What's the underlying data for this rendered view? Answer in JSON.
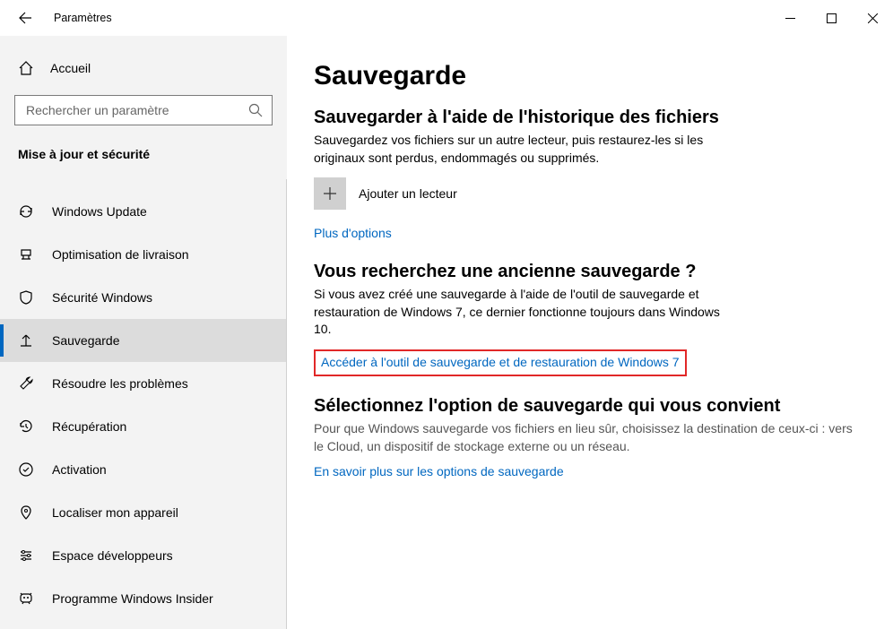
{
  "window": {
    "title": "Paramètres"
  },
  "sidebar": {
    "home": "Accueil",
    "search_placeholder": "Rechercher un paramètre",
    "section_label": "Mise à jour et sécurité",
    "items": [
      {
        "label": "Windows Update",
        "selected": false
      },
      {
        "label": "Optimisation de livraison",
        "selected": false
      },
      {
        "label": "Sécurité Windows",
        "selected": false
      },
      {
        "label": "Sauvegarde",
        "selected": true
      },
      {
        "label": "Résoudre les problèmes",
        "selected": false
      },
      {
        "label": "Récupération",
        "selected": false
      },
      {
        "label": "Activation",
        "selected": false
      },
      {
        "label": "Localiser mon appareil",
        "selected": false
      },
      {
        "label": "Espace développeurs",
        "selected": false
      },
      {
        "label": "Programme Windows Insider",
        "selected": false
      }
    ]
  },
  "main": {
    "page_title": "Sauvegarde",
    "s1_title": "Sauvegarder à l'aide de l'historique des fichiers",
    "s1_desc": "Sauvegardez vos fichiers sur un autre lecteur, puis restaurez-les si les originaux sont perdus, endommagés ou supprimés.",
    "add_drive": "Ajouter un lecteur",
    "more_options": "Plus d'options",
    "s2_title": "Vous recherchez une ancienne sauvegarde ?",
    "s2_desc": "Si vous avez créé une sauvegarde à l'aide de l'outil de sauvegarde et restauration de Windows 7, ce dernier fonctionne toujours dans Windows 10.",
    "win7_link": "Accéder à l'outil de sauvegarde et de restauration de Windows 7",
    "s3_title": "Sélectionnez l'option de sauvegarde qui vous convient",
    "s3_desc": "Pour que Windows sauvegarde vos fichiers en lieu sûr, choisissez la destination de ceux-ci : vers le Cloud, un dispositif de stockage externe ou un réseau.",
    "s3_link": "En savoir plus sur les options de sauvegarde"
  }
}
